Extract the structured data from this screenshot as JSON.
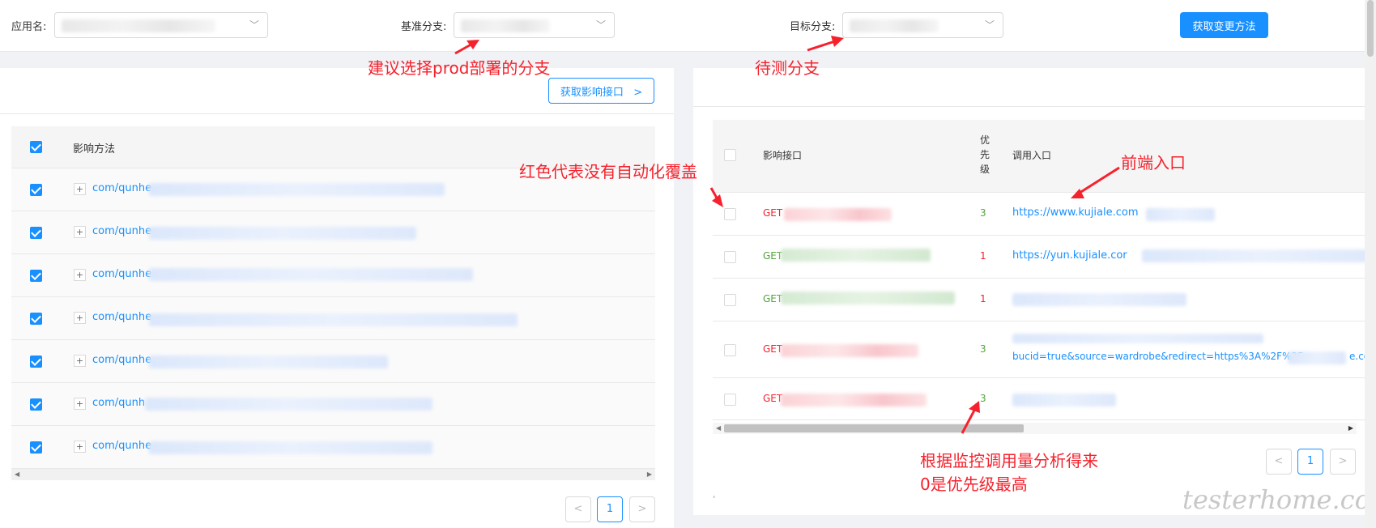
{
  "filters": {
    "app_label": "应用名:",
    "base_label": "基准分支:",
    "target_label": "目标分支:",
    "fetch_button": "获取变更方法"
  },
  "left": {
    "fetch_button": "获取影响接口",
    "header": "影响方法",
    "rows": [
      "com/qunhe",
      "com/qunhe",
      "com/qunhe",
      "com/qunhe",
      "com/qunhe",
      "com/qunh",
      "com/qunhe"
    ],
    "page": "1"
  },
  "right": {
    "col_interface": "影响接口",
    "col_priority": "优先级",
    "col_entry": "调用入口",
    "rows": [
      {
        "method": "GET",
        "method_color": "red",
        "priority": "3",
        "priority_color": "green",
        "entry": "https://www.kujiale.com"
      },
      {
        "method": "GET",
        "method_color": "green",
        "priority": "1",
        "priority_color": "red",
        "entry": "https://yun.kujiale.cor"
      },
      {
        "method": "GET",
        "method_color": "green",
        "priority": "1",
        "priority_color": "red",
        "entry": ""
      },
      {
        "method": "GET",
        "method_color": "red",
        "priority": "3",
        "priority_color": "green",
        "entry": "bucid=true&source=wardrobe&redirect=https%3A%2F%2Fw",
        "entry_tail": "e.co"
      },
      {
        "method": "GET",
        "method_color": "red",
        "priority": "3",
        "priority_color": "green",
        "entry": ""
      }
    ],
    "page": "1",
    "footnote": ","
  },
  "annotations": {
    "base_branch": "建议选择prod部署的分支",
    "target_branch": "待测分支",
    "red_meaning": "红色代表没有自动化覆盖",
    "frontend_entry": "前端入口",
    "priority_line1": "根据监控调用量分析得来",
    "priority_line2": "0是优先级最高"
  },
  "watermark": "testerhome.com",
  "colors": {
    "accent": "#1890ff",
    "annotation": "#f5222d",
    "uncovered": "#f5222d",
    "covered": "#52a43a"
  }
}
